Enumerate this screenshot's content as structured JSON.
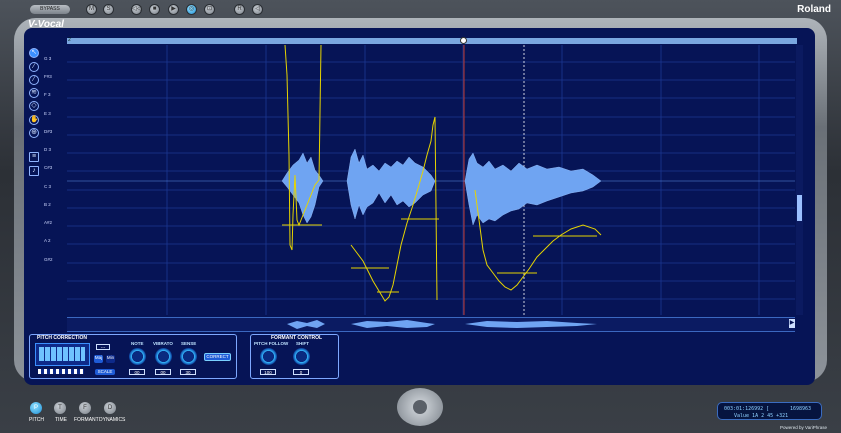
{
  "app": {
    "name": "V-Vocal",
    "brand": "Roland",
    "powered_by": "Powered by VariPhrase",
    "bypass_label": "BYPASS"
  },
  "toolbar": {
    "buttons": [
      "M",
      "S",
      "◁◁",
      "■",
      "▶",
      "◎",
      "⊡",
      "R",
      "◁"
    ],
    "active_index": 5
  },
  "tools": [
    {
      "icon": "pointer-icon",
      "glyph": "↖"
    },
    {
      "icon": "pencil-icon",
      "glyph": "∕"
    },
    {
      "icon": "line-icon",
      "glyph": "⁄"
    },
    {
      "icon": "vibrato-icon",
      "glyph": "≋"
    },
    {
      "icon": "eraser-icon",
      "glyph": "◇"
    },
    {
      "icon": "hand-icon",
      "glyph": "✋"
    },
    {
      "icon": "zoom-icon",
      "glyph": "⊕"
    },
    {
      "icon": "waveform-view-icon",
      "glyph": "≡"
    },
    {
      "icon": "note-view-icon",
      "glyph": "♪"
    }
  ],
  "ruler": {
    "label": "2"
  },
  "notes": [
    "G 3",
    "F#3",
    "F 3",
    "E 3",
    "D#3",
    "D 3",
    "C#3",
    "C 3",
    "B 2",
    "A#2",
    "A 2",
    "G#2"
  ],
  "pitch_correction": {
    "title": "PITCH CORRECTION",
    "note": {
      "label": "NOTE",
      "value": "00"
    },
    "vibrato": {
      "label": "VIBRATO",
      "value": "00"
    },
    "sense": {
      "label": "SENSE",
      "value": "30"
    },
    "maj_label": "Maj",
    "min_label": "Min",
    "scale_label": "SCALE",
    "correct_label": "CORRECT",
    "key_value": "---"
  },
  "formant_control": {
    "title": "FORMANT CONTROL",
    "pitch_follow": {
      "label": "PITCH FOLLOW",
      "value": "100"
    },
    "shift": {
      "label": "SHIFT",
      "value": "0"
    }
  },
  "modes": [
    {
      "letter": "P",
      "label": "PITCH",
      "active": true
    },
    {
      "letter": "T",
      "label": "TIME",
      "active": false
    },
    {
      "letter": "F",
      "label": "FORMANT",
      "active": false
    },
    {
      "letter": "D",
      "label": "DYNAMICS",
      "active": false
    }
  ],
  "status": {
    "line1_left": "003:01:126992 [",
    "line1_right": "1698963",
    "line2": "Value 1A  2  45  +321"
  },
  "colors": {
    "screen": "#061456",
    "grid": "#1f3a9a",
    "waveform": "#7fb2ff",
    "pitch": "#e6d400",
    "accent": "#35b9ff"
  }
}
